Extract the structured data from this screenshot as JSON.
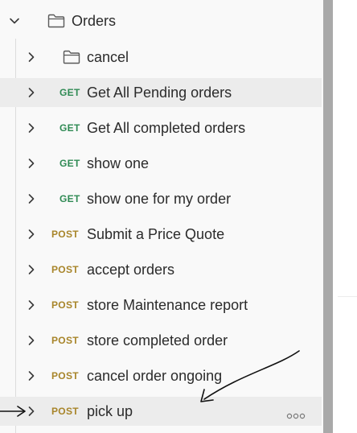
{
  "folder": {
    "name": "Orders",
    "expanded": true
  },
  "items": [
    {
      "kind": "folder",
      "label": "cancel"
    },
    {
      "kind": "request",
      "method": "GET",
      "label": "Get All Pending orders",
      "highlighted": true
    },
    {
      "kind": "request",
      "method": "GET",
      "label": "Get All completed orders"
    },
    {
      "kind": "request",
      "method": "GET",
      "label": "show one"
    },
    {
      "kind": "request",
      "method": "GET",
      "label": "show one for my order"
    },
    {
      "kind": "request",
      "method": "POST",
      "label": "Submit a Price Quote"
    },
    {
      "kind": "request",
      "method": "POST",
      "label": "accept orders"
    },
    {
      "kind": "request",
      "method": "POST",
      "label": "store Maintenance report"
    },
    {
      "kind": "request",
      "method": "POST",
      "label": "store completed order"
    },
    {
      "kind": "request",
      "method": "POST",
      "label": "cancel order ongoing"
    },
    {
      "kind": "request",
      "method": "POST",
      "label": "pick up",
      "highlighted": true,
      "hovered": true
    }
  ],
  "colors": {
    "get": "#2f8a54",
    "post": "#a8852a",
    "highlight": "#ececec",
    "panel": "#f9f9f9"
  },
  "icons": {
    "expanded": "chevron-down-icon",
    "collapsed": "chevron-right-icon",
    "folder": "folder-icon",
    "more": "more-horizontal-icon"
  }
}
